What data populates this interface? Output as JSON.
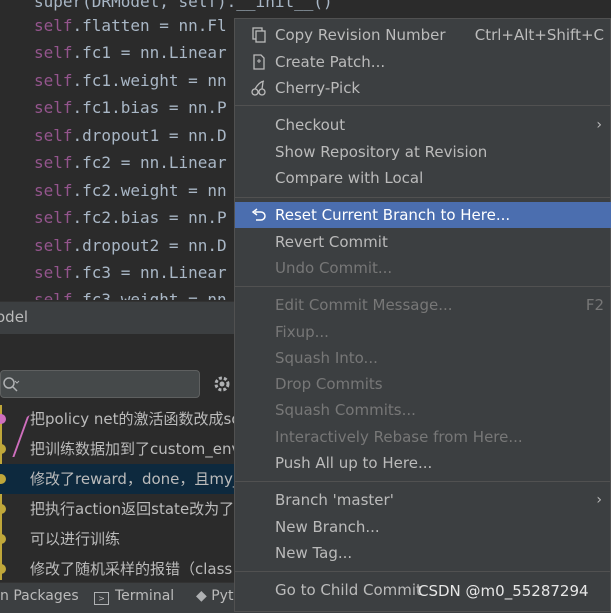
{
  "editor": {
    "lines": [
      {
        "prefix": "super(",
        "rest": "DRModel, self).__init__()"
      },
      {
        "self": "self",
        "rest": ".flatten = nn.Fl"
      },
      {
        "self": "self",
        "rest": ".fc1 = nn.Linear"
      },
      {
        "self": "self",
        "rest": ".fc1.weight = nn"
      },
      {
        "self": "self",
        "rest": ".fc1.bias = nn.P"
      },
      {
        "self": "self",
        "rest": ".dropout1 = nn.D"
      },
      {
        "self": "self",
        "rest": ".fc2 = nn.Linear"
      },
      {
        "self": "self",
        "rest": ".fc2.weight = nn"
      },
      {
        "self": "self",
        "rest": ".fc2.bias = nn.P"
      },
      {
        "self": "self",
        "rest": ".dropout2 = nn.D"
      },
      {
        "self": "self",
        "rest": ".fc3 = nn.Linear"
      },
      {
        "self": "self",
        "rest": ".fc3.weight = nn"
      }
    ]
  },
  "toolwindow": {
    "title": "odel"
  },
  "git_log": {
    "commits": [
      "把policy net的激活函数改成sof",
      "把训练数据加到了custom_env",
      "修改了reward，done，且my_",
      "把执行action返回state改为了图",
      "可以进行训练",
      "修改了随机采样的报错（class"
    ]
  },
  "bottom_tabs": [
    "n Packages",
    "Terminal",
    "Pyt"
  ],
  "context_menu": {
    "items": [
      {
        "label": "Copy Revision Number",
        "shortcut": "Ctrl+Alt+Shift+C",
        "icon": "copy-icon",
        "enabled": true
      },
      {
        "label": "Create Patch...",
        "icon": "patch-icon",
        "enabled": true
      },
      {
        "label": "Cherry-Pick",
        "icon": "cherry-icon",
        "enabled": true
      },
      {
        "label": "Checkout",
        "submenu": true,
        "enabled": true
      },
      {
        "label": "Show Repository at Revision",
        "enabled": true
      },
      {
        "label": "Compare with Local",
        "enabled": true
      },
      {
        "label": "Reset Current Branch to Here...",
        "icon": "undo-icon",
        "enabled": true,
        "highlighted": true
      },
      {
        "label": "Revert Commit",
        "enabled": true
      },
      {
        "label": "Undo Commit...",
        "enabled": false
      },
      {
        "label": "Edit Commit Message...",
        "shortcut": "F2",
        "enabled": false
      },
      {
        "label": "Fixup...",
        "enabled": false
      },
      {
        "label": "Squash Into...",
        "enabled": false
      },
      {
        "label": "Drop Commits",
        "enabled": false
      },
      {
        "label": "Squash Commits...",
        "enabled": false
      },
      {
        "label": "Interactively Rebase from Here...",
        "enabled": false
      },
      {
        "label": "Push All up to Here...",
        "enabled": true
      },
      {
        "label": "Branch 'master'",
        "submenu": true,
        "enabled": true
      },
      {
        "label": "New Branch...",
        "enabled": true
      },
      {
        "label": "New Tag...",
        "enabled": true
      },
      {
        "label": "Go to Child Commit",
        "enabled": true
      }
    ],
    "arrow_glyph": "›"
  },
  "watermark": "CSDN @m0_55287294",
  "colors": {
    "highlight": "#4b6eaf",
    "menu_bg": "#3c3f41",
    "editor_bg": "#2b2b2b"
  }
}
